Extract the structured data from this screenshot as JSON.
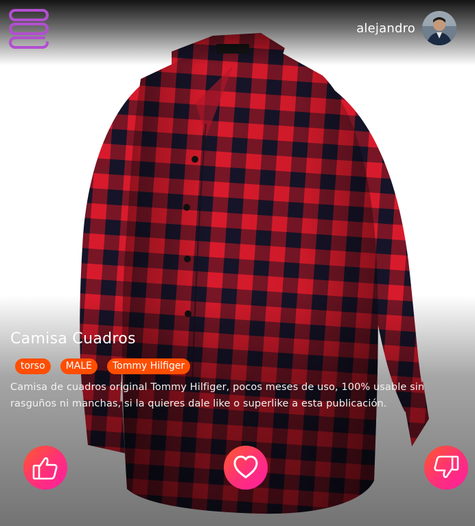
{
  "header": {
    "username": "alejandro",
    "icons": {
      "menu": "menu-icon",
      "avatar": "user-avatar"
    }
  },
  "product": {
    "title": "Camisa Cuadros",
    "tags": [
      "torso",
      "MALE",
      "Tommy Hilfiger"
    ],
    "description": "Camisa de cuadros original Tommy Hilfiger, pocos meses de uso, 100% usable sin rasguños ni manchas, si la quieres dale like o superlike a esta publicación."
  },
  "actions": {
    "like": "thumbs-up-icon",
    "superlike": "heart-icon",
    "dislike": "thumbs-down-icon"
  },
  "colors": {
    "accent_gradient_start": "#ff5a2a",
    "accent_gradient_end": "#ff1fa0",
    "tag_bg": "#ff4e00",
    "menu_icon": "#b24fd0",
    "shirt_red": "#d81b2c",
    "shirt_navy": "#1a1830"
  }
}
